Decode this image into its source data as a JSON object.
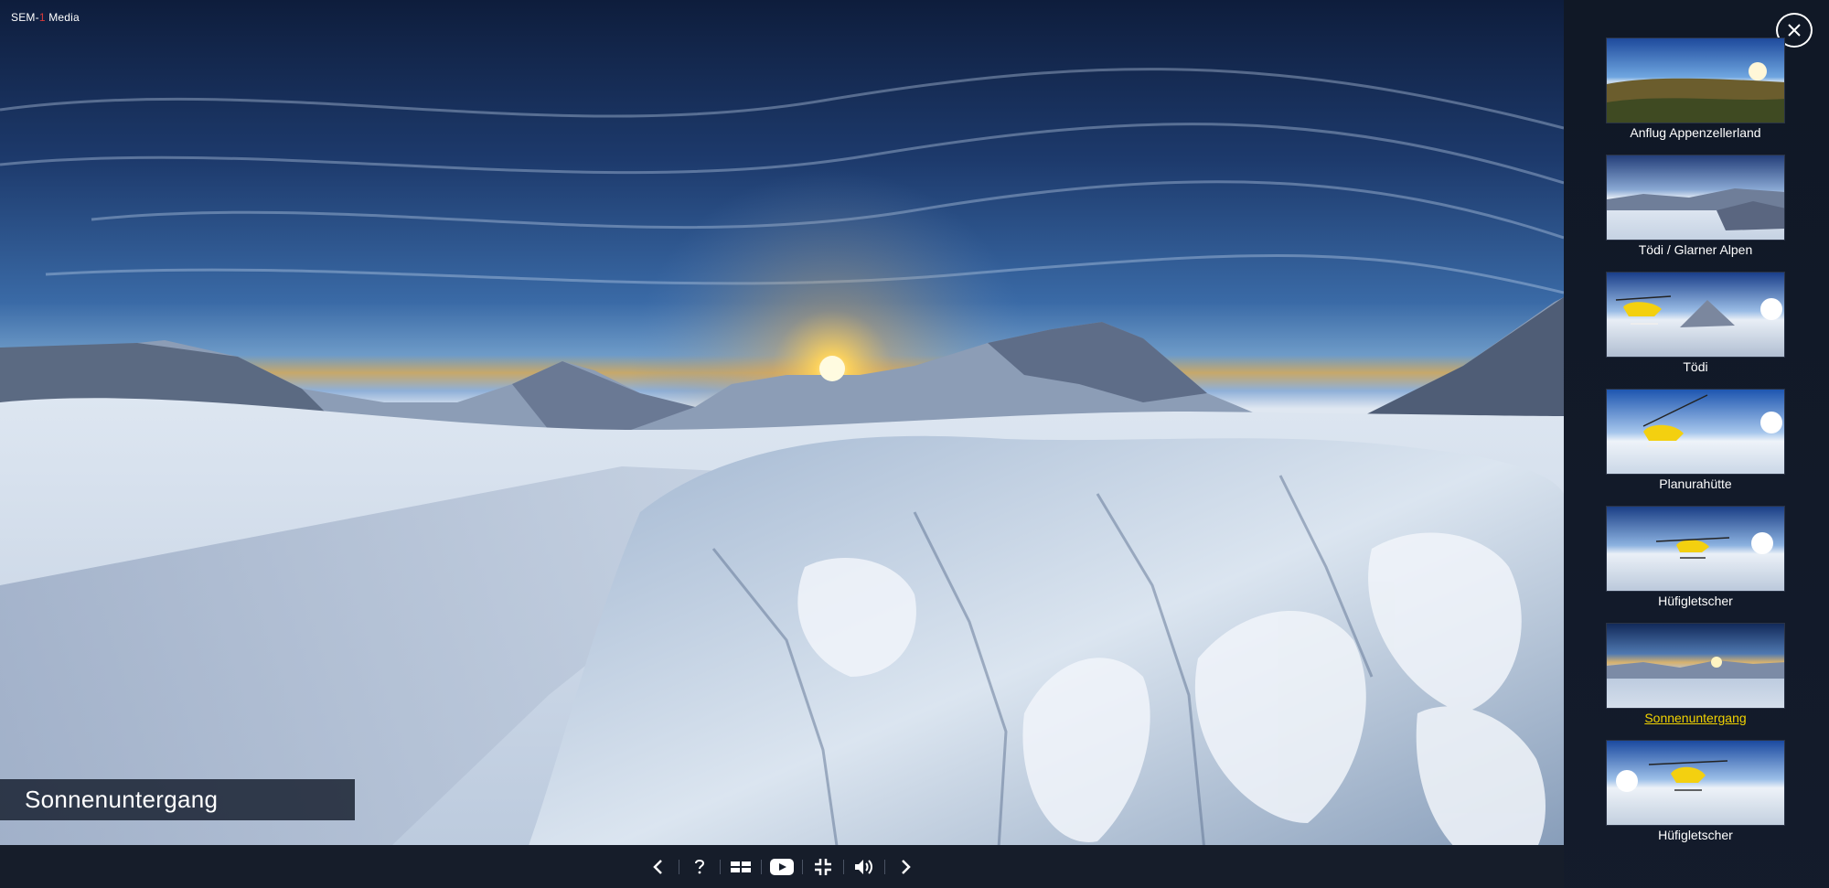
{
  "brand": {
    "name_part1": "SEM-",
    "name_dash": "1",
    "name_part2": " Media"
  },
  "scene": {
    "title": "Sonnenuntergang"
  },
  "toolbar": {
    "items": [
      {
        "name": "prev-icon"
      },
      {
        "name": "help-icon"
      },
      {
        "name": "thumbnails-icon"
      },
      {
        "name": "video-icon"
      },
      {
        "name": "exit-fullscreen-icon"
      },
      {
        "name": "sound-icon"
      },
      {
        "name": "next-icon"
      }
    ]
  },
  "sidebar": {
    "close_icon": "close-icon",
    "items": [
      {
        "label": "Anflug Appenzellerland",
        "active": false
      },
      {
        "label": "Tödi / Glarner Alpen",
        "active": false
      },
      {
        "label": "Tödi",
        "active": false
      },
      {
        "label": "Planurahütte",
        "active": false
      },
      {
        "label": "Hüfigletscher",
        "active": false
      },
      {
        "label": "Sonnenuntergang",
        "active": true
      },
      {
        "label": "Hüfigletscher",
        "active": false
      }
    ]
  },
  "colors": {
    "active_label": "#f2d300",
    "brand_accent": "#d83a3a",
    "toolbar_bg": "#161d2a"
  }
}
